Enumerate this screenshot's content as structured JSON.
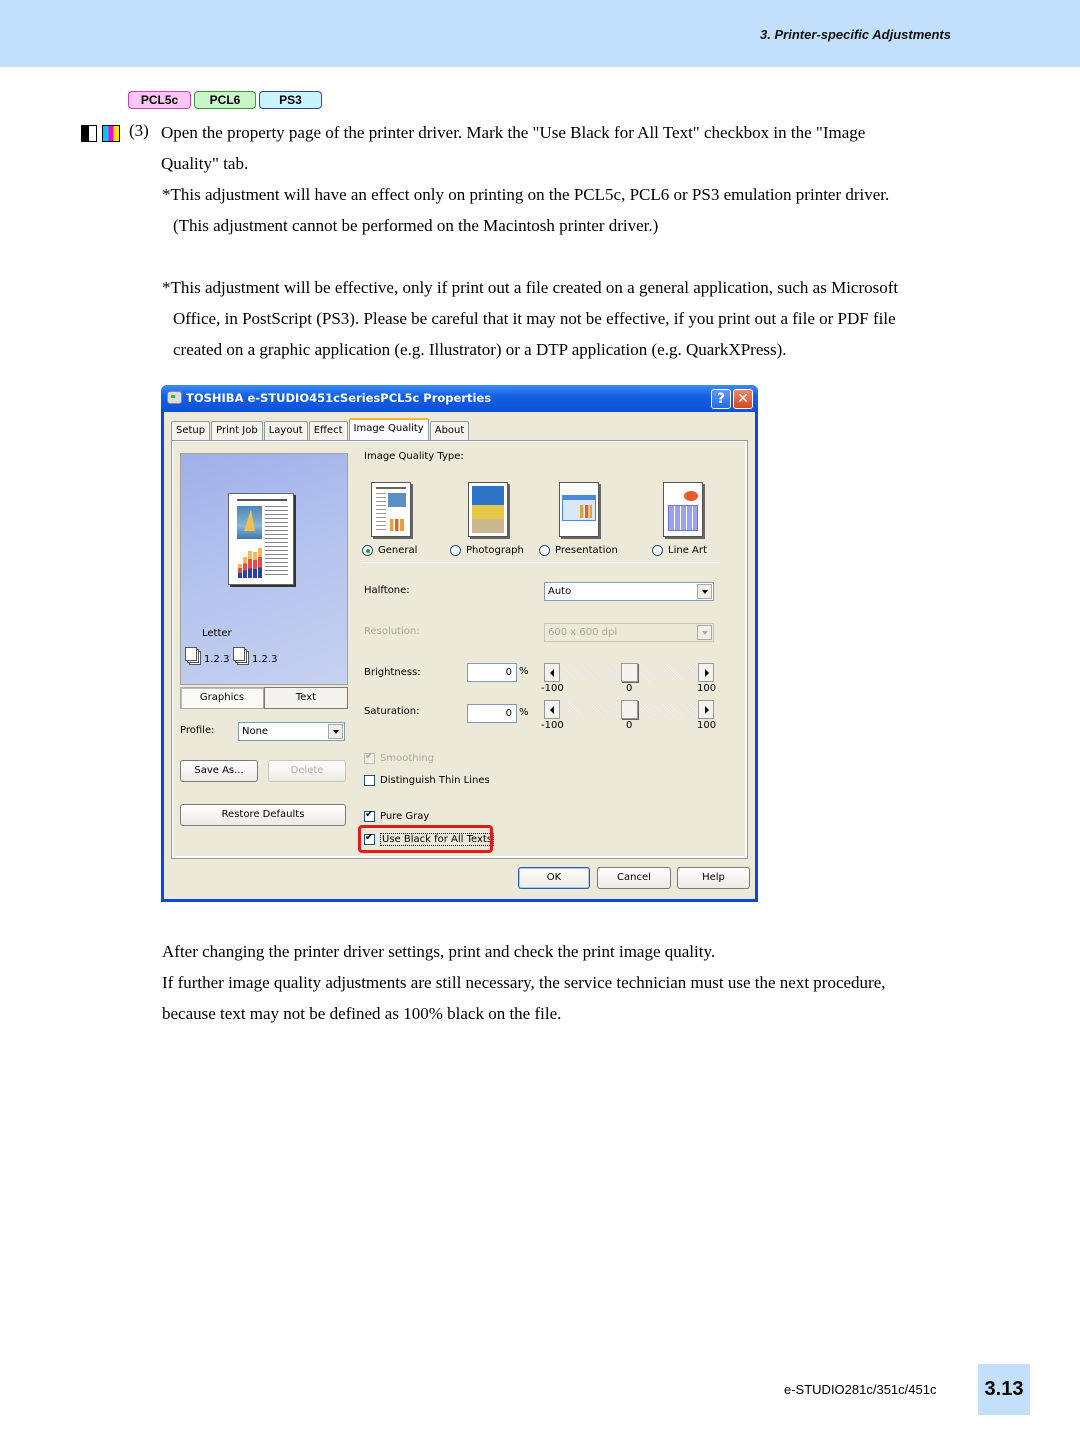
{
  "header": {
    "section_title": "3. Printer-specific Adjustments"
  },
  "badges": [
    "PCL5c",
    "PCL6",
    "PS3"
  ],
  "step": {
    "icons": [
      "monochrome-mode-icon",
      "color-mode-icon"
    ],
    "number": "(3)",
    "lines": [
      "Open the property page of the printer driver.  Mark the \"Use Black for All Text\" checkbox in the \"Image",
      "Quality\" tab."
    ],
    "note1": [
      "*This adjustment will have an effect only on printing on the PCL5c, PCL6 or PS3 emulation printer driver.",
      "(This adjustment cannot be performed on the Macintosh printer driver.)"
    ],
    "note2": [
      "*This adjustment will be effective, only if print out a file created on a general application, such as Microsoft",
      "Office, in PostScript (PS3).  Please be careful that it may not be effective, if you print out a file or PDF file",
      "created on a graphic application (e.g. Illustrator) or a DTP application (e.g. QuarkXPress)."
    ]
  },
  "dialog": {
    "title": "TOSHIBA e-STUDIO451cSeriesPCL5c Properties",
    "help_glyph": "?",
    "close_glyph": "✕",
    "tabs": [
      "Setup",
      "Print Job",
      "Layout",
      "Effect",
      "Image Quality",
      "About"
    ],
    "active_tab": "Image Quality",
    "preview": {
      "paper_size": "Letter",
      "copies_label_1": "1.2.3",
      "copies_label_2": "1.2.3"
    },
    "mode_buttons": [
      "Graphics",
      "Text"
    ],
    "profile_label": "Profile:",
    "profile_value": "None",
    "save_as": "Save As...",
    "delete": "Delete",
    "restore_defaults": "Restore Defaults",
    "image_quality_type_label": "Image Quality Type:",
    "image_quality_types": [
      {
        "label": "General",
        "selected": true
      },
      {
        "label": "Photograph",
        "selected": false
      },
      {
        "label": "Presentation",
        "selected": false
      },
      {
        "label": "Line Art",
        "selected": false
      }
    ],
    "halftone_label": "Halftone:",
    "halftone_value": "Auto",
    "resolution_label": "Resolution:",
    "resolution_value": "600 x 600 dpi",
    "brightness_label": "Brightness:",
    "brightness_value": "0",
    "saturation_label": "Saturation:",
    "saturation_value": "0",
    "percent": "%",
    "slider_ticks": [
      "-100",
      "0",
      "100"
    ],
    "brightness_slider": {
      "min": -100,
      "max": 100,
      "value": 0
    },
    "saturation_slider": {
      "min": -100,
      "max": 100,
      "value": 0
    },
    "checkboxes": [
      {
        "label": "Smoothing",
        "checked": true,
        "disabled": true
      },
      {
        "label": "Distinguish Thin Lines",
        "checked": false,
        "disabled": false
      },
      {
        "label": "Pure Gray",
        "checked": true,
        "disabled": false
      },
      {
        "label": "Use Black for All Texts",
        "checked": true,
        "disabled": false,
        "highlighted": true
      }
    ],
    "footer_buttons": [
      "OK",
      "Cancel",
      "Help"
    ],
    "highlight_color": "#e31b1b"
  },
  "after": [
    "After changing the printer driver settings, print and check the print image quality.",
    "If further image quality adjustments are still necessary, the service technician must use the next procedure,",
    "because text may not be defined as 100% black on the file."
  ],
  "footer": {
    "model": "e-STUDIO281c/351c/451c",
    "page": "3.13"
  },
  "colors": {
    "header_band": "#c2e0fb",
    "xp_title_blue": "#0a52d8",
    "dialog_bg": "#ece9d8"
  }
}
